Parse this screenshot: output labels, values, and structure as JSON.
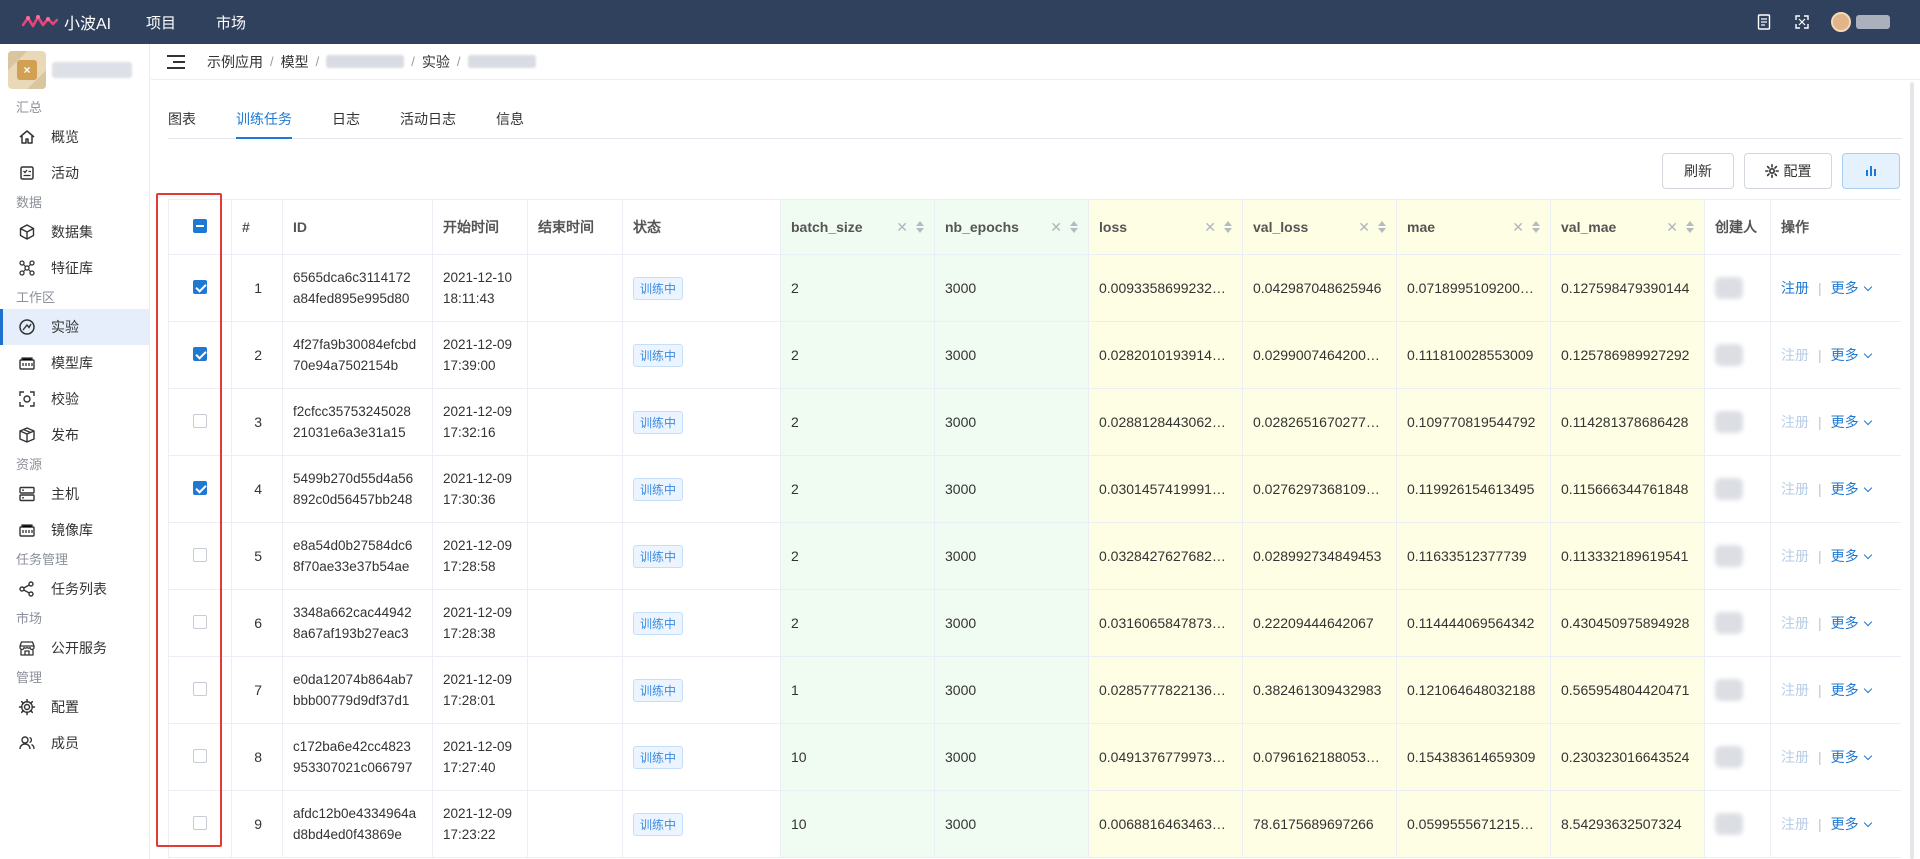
{
  "app": {
    "brand": "小波AI",
    "brand_color": "#30415d",
    "accent": "#1f78d1"
  },
  "topnav": [
    "项目",
    "市场"
  ],
  "sidebar": {
    "sections": [
      {
        "title": "汇总",
        "items": [
          {
            "label": "概览",
            "icon": "home-icon"
          },
          {
            "label": "活动",
            "icon": "activity-icon"
          }
        ]
      },
      {
        "title": "数据",
        "items": [
          {
            "label": "数据集",
            "icon": "dataset-cube-icon"
          },
          {
            "label": "特征库",
            "icon": "feature-graph-icon"
          }
        ]
      },
      {
        "title": "工作区",
        "items": [
          {
            "label": "实验",
            "icon": "experiment-icon",
            "active": true
          },
          {
            "label": "模型库",
            "icon": "model-library-icon"
          },
          {
            "label": "校验",
            "icon": "validate-scan-icon"
          },
          {
            "label": "发布",
            "icon": "publish-box-icon"
          }
        ]
      },
      {
        "title": "资源",
        "items": [
          {
            "label": "主机",
            "icon": "server-icon"
          },
          {
            "label": "镜像库",
            "icon": "image-repo-icon"
          }
        ]
      },
      {
        "title": "任务管理",
        "items": [
          {
            "label": "任务列表",
            "icon": "task-share-icon"
          }
        ]
      },
      {
        "title": "市场",
        "items": [
          {
            "label": "公开服务",
            "icon": "storefront-icon"
          }
        ]
      },
      {
        "title": "管理",
        "items": [
          {
            "label": "配置",
            "icon": "gear-icon"
          },
          {
            "label": "成员",
            "icon": "members-icon"
          }
        ]
      }
    ]
  },
  "breadcrumb": {
    "items": [
      "示例应用",
      "模型",
      "实验"
    ]
  },
  "tabs": [
    "图表",
    "训练任务",
    "日志",
    "活动日志",
    "信息"
  ],
  "toolbar": {
    "refresh": "刷新",
    "config": "配置"
  },
  "table": {
    "columns": [
      "#",
      "ID",
      "开始时间",
      "结束时间",
      "状态",
      "batch_size",
      "nb_epochs",
      "loss",
      "val_loss",
      "mae",
      "val_mae",
      "创建人",
      "操作"
    ],
    "op_register": "注册",
    "op_more": "更多",
    "rows": [
      {
        "idx": "1",
        "id1": "6565dca6c3114172",
        "id2": "a84fed895e995d80",
        "date": "2021-12-10",
        "time": "18:11:43",
        "status": "训练中",
        "batch_size": "2",
        "nb_epochs": "3000",
        "loss": "0.0093358699232…",
        "val_loss": "0.042987048625946",
        "mae": "0.0718995109200…",
        "val_mae": "0.127598479390144",
        "checked": true,
        "reg_enabled": true
      },
      {
        "idx": "2",
        "id1": "4f27fa9b30084efcbd",
        "id2": "70e94a7502154b",
        "date": "2021-12-09",
        "time": "17:39:00",
        "status": "训练中",
        "batch_size": "2",
        "nb_epochs": "3000",
        "loss": "0.0282010193914…",
        "val_loss": "0.0299007464200…",
        "mae": "0.111810028553009",
        "val_mae": "0.125786989927292",
        "checked": true,
        "reg_enabled": false
      },
      {
        "idx": "3",
        "id1": "f2cfcc35753245028",
        "id2": "21031e6a3e31a15",
        "date": "2021-12-09",
        "time": "17:32:16",
        "status": "训练中",
        "batch_size": "2",
        "nb_epochs": "3000",
        "loss": "0.0288128443062…",
        "val_loss": "0.0282651670277…",
        "mae": "0.109770819544792",
        "val_mae": "0.114281378686428",
        "checked": false,
        "reg_enabled": false
      },
      {
        "idx": "4",
        "id1": "5499b270d55d4a56",
        "id2": "892c0d56457bb248",
        "date": "2021-12-09",
        "time": "17:30:36",
        "status": "训练中",
        "batch_size": "2",
        "nb_epochs": "3000",
        "loss": "0.0301457419991…",
        "val_loss": "0.0276297368109…",
        "mae": "0.119926154613495",
        "val_mae": "0.115666344761848",
        "checked": true,
        "reg_enabled": false
      },
      {
        "idx": "5",
        "id1": "e8a54d0b27584dc6",
        "id2": "8f70ae33e37b54ae",
        "date": "2021-12-09",
        "time": "17:28:58",
        "status": "训练中",
        "batch_size": "2",
        "nb_epochs": "3000",
        "loss": "0.0328427627682…",
        "val_loss": "0.028992734849453",
        "mae": "0.11633512377739",
        "val_mae": "0.113332189619541",
        "checked": false,
        "reg_enabled": false
      },
      {
        "idx": "6",
        "id1": "3348a662cac44942",
        "id2": "8a67af193b27eac3",
        "date": "2021-12-09",
        "time": "17:28:38",
        "status": "训练中",
        "batch_size": "2",
        "nb_epochs": "3000",
        "loss": "0.0316065847873…",
        "val_loss": "0.22209444642067",
        "mae": "0.114444069564342",
        "val_mae": "0.430450975894928",
        "checked": false,
        "reg_enabled": false
      },
      {
        "idx": "7",
        "id1": "e0da12074b864ab7",
        "id2": "bbb00779d9df37d1",
        "date": "2021-12-09",
        "time": "17:28:01",
        "status": "训练中",
        "batch_size": "1",
        "nb_epochs": "3000",
        "loss": "0.0285777822136…",
        "val_loss": "0.382461309432983",
        "mae": "0.121064648032188",
        "val_mae": "0.565954804420471",
        "checked": false,
        "reg_enabled": false
      },
      {
        "idx": "8",
        "id1": "c172ba6e42cc4823",
        "id2": "953307021c066797",
        "date": "2021-12-09",
        "time": "17:27:40",
        "status": "训练中",
        "batch_size": "10",
        "nb_epochs": "3000",
        "loss": "0.0491376779973…",
        "val_loss": "0.0796162188053…",
        "mae": "0.154383614659309",
        "val_mae": "0.230323016643524",
        "checked": false,
        "reg_enabled": false
      },
      {
        "idx": "9",
        "id1": "afdc12b0e4334964a",
        "id2": "d8bd4ed0f43869e",
        "date": "2021-12-09",
        "time": "17:23:22",
        "status": "训练中",
        "batch_size": "10",
        "nb_epochs": "3000",
        "loss": "0.0068816463463…",
        "val_loss": "78.6175689697266",
        "mae": "0.0599555671215…",
        "val_mae": "8.54293632507324",
        "checked": false,
        "reg_enabled": false
      }
    ]
  }
}
